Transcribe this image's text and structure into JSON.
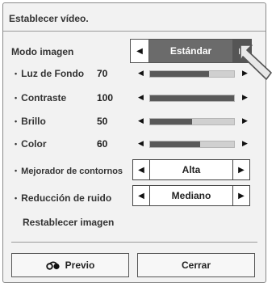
{
  "dialog": {
    "title": "Establecer vídeo."
  },
  "picture_mode": {
    "label": "Modo imagen",
    "value": "Estándar"
  },
  "sliders": [
    {
      "label": "Luz de Fondo",
      "value": "70",
      "level": 0.7
    },
    {
      "label": "Contraste",
      "value": "100",
      "level": 1.0
    },
    {
      "label": "Brillo",
      "value": "50",
      "level": 0.5
    },
    {
      "label": "Color",
      "value": "60",
      "level": 0.6
    }
  ],
  "selects": [
    {
      "label": "Mejorador de contornos",
      "value": "Alta"
    },
    {
      "label": "Reducción de ruido",
      "value": "Mediano"
    }
  ],
  "reset": {
    "label": "Restablecer imagen"
  },
  "buttons": {
    "prev": "Previo",
    "close": "Cerrar"
  },
  "icons": {
    "left_arrow": "◀",
    "right_arrow": "▶",
    "bullet": "•",
    "back": "back-arrow-icon",
    "pointer": "hand-pointer-icon"
  },
  "colors": {
    "selected_bg": "#6b6b6b",
    "slider_fill": "#595959",
    "slider_track": "#d0d0d0"
  }
}
